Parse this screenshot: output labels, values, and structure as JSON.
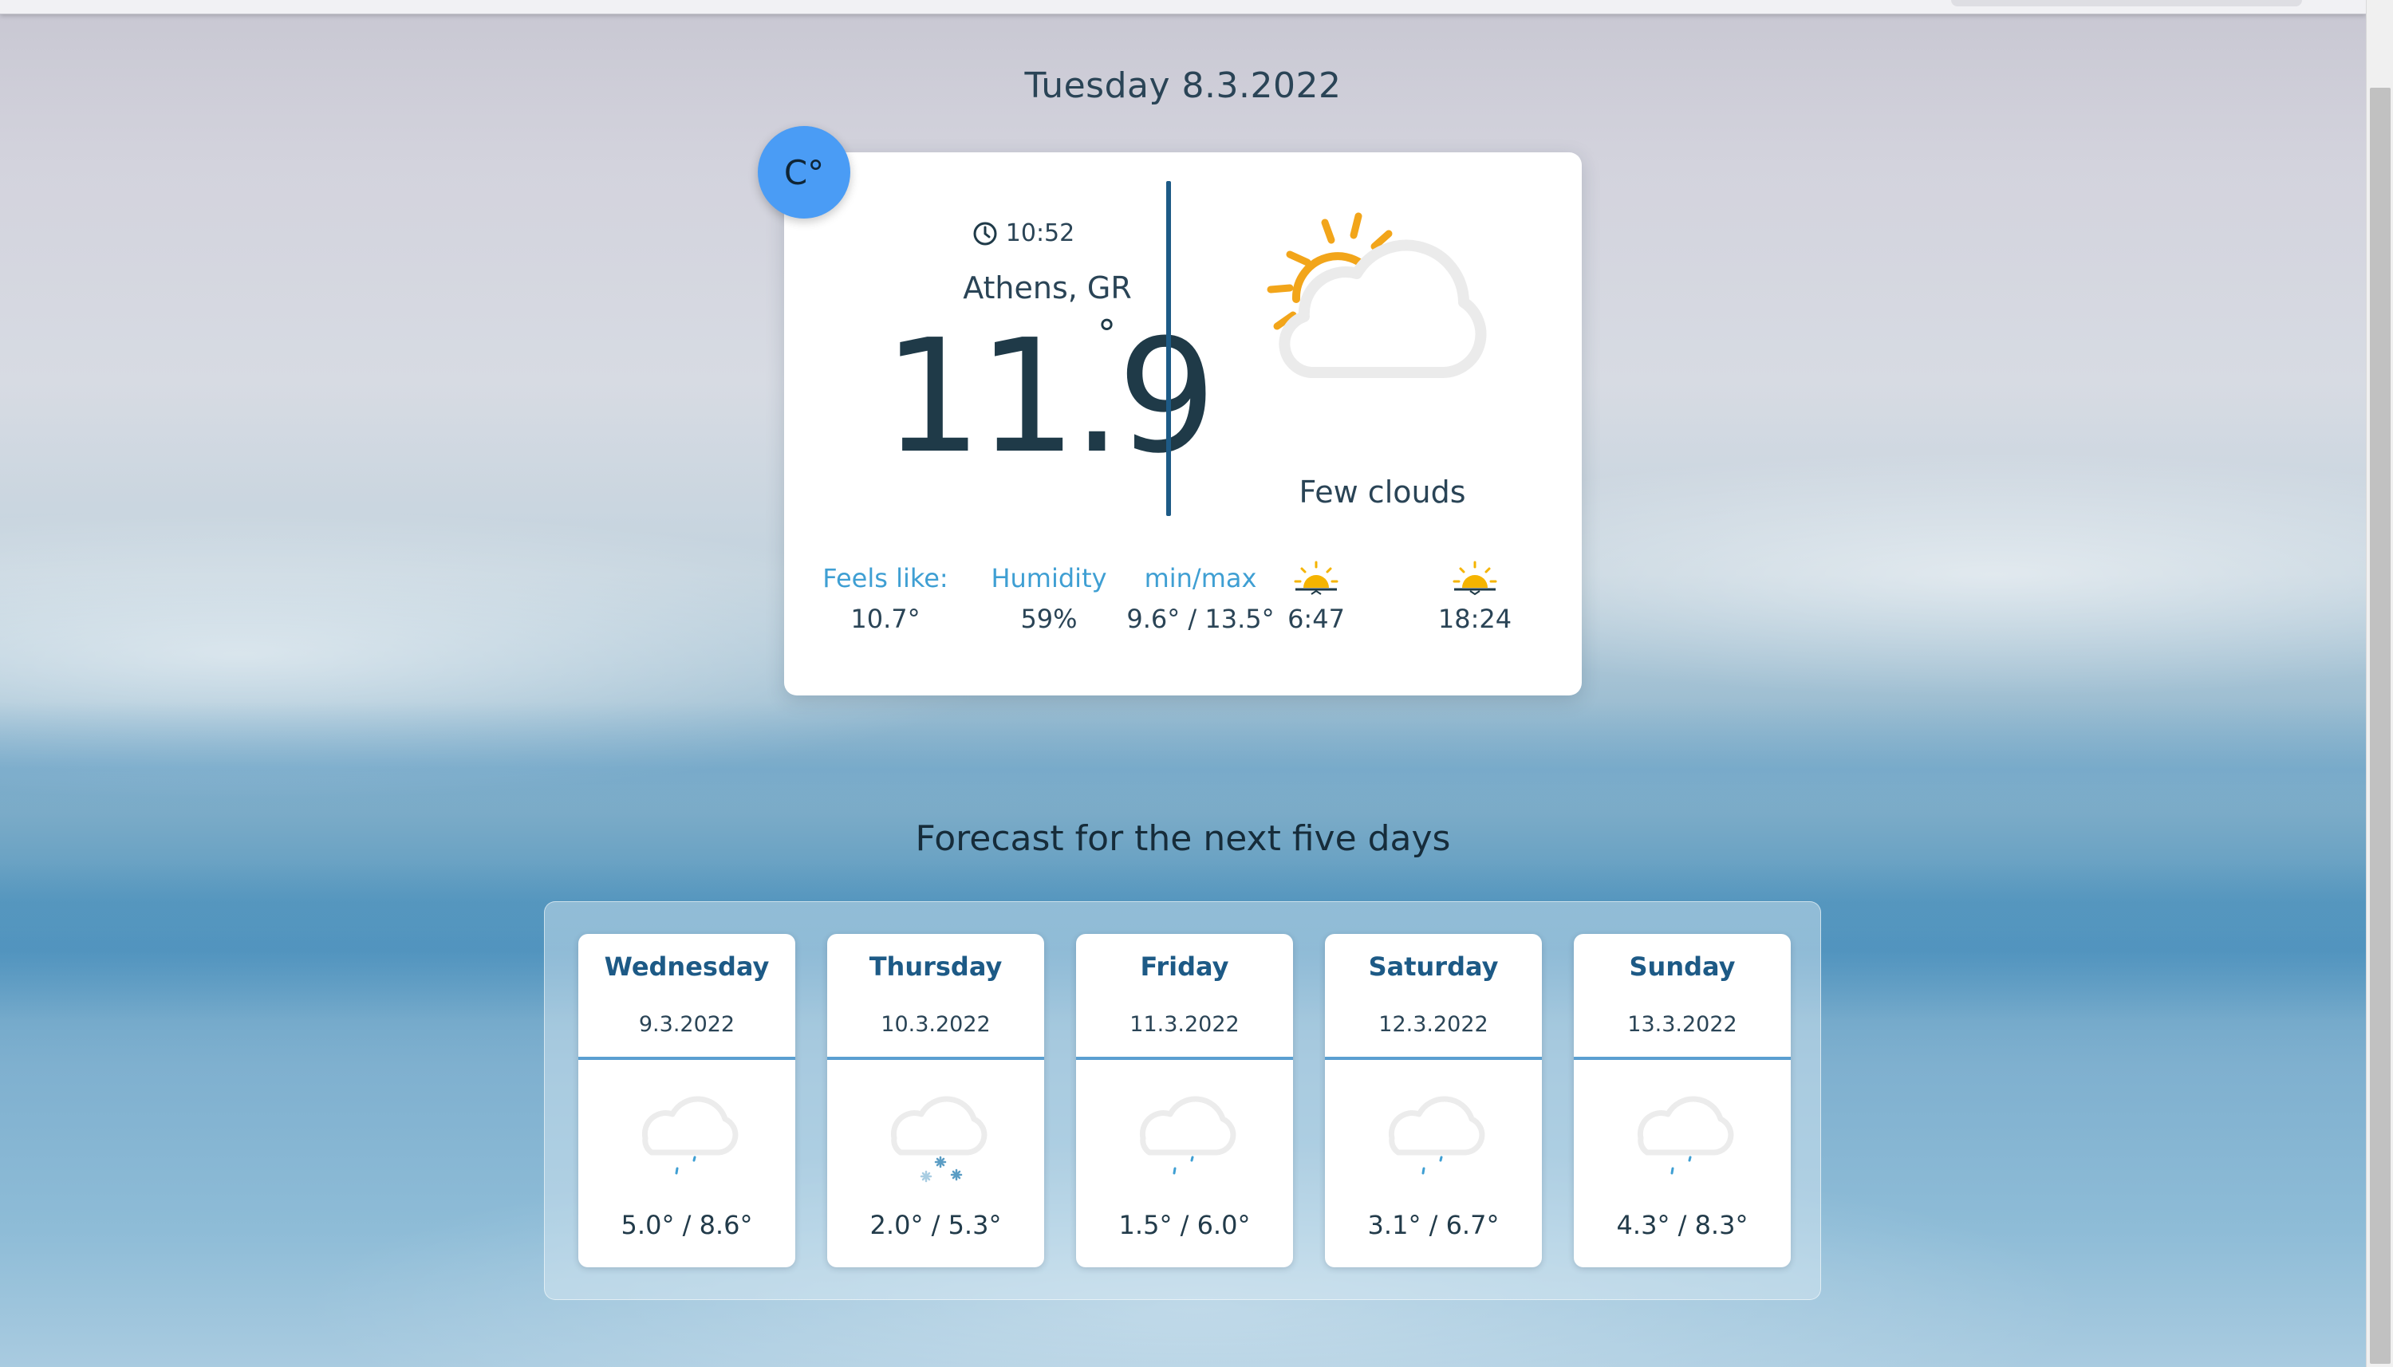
{
  "header": {
    "date": "Tuesday 8.3.2022"
  },
  "unit_toggle": {
    "label": "C°"
  },
  "current": {
    "time": "10:52",
    "city": "Athens, GR",
    "temperature": "11.9",
    "degree_symbol": "°",
    "condition": "Few clouds",
    "icon": "sun-behind-cloud-icon",
    "stats": [
      {
        "label": "Feels like:",
        "value": "10.7°"
      },
      {
        "label": "Humidity",
        "value": "59%"
      },
      {
        "label": "min/max",
        "value": "9.6° / 13.5°"
      }
    ],
    "sunrise": {
      "icon": "sunrise-icon",
      "value": "6:47"
    },
    "sunset": {
      "icon": "sunset-icon",
      "value": "18:24"
    }
  },
  "forecast": {
    "heading": "Forecast for the next five days",
    "days": [
      {
        "name": "Wednesday",
        "date": "9.3.2022",
        "range": "5.0° / 8.6°",
        "icon": "cloud-rain-icon"
      },
      {
        "name": "Thursday",
        "date": "10.3.2022",
        "range": "2.0° / 5.3°",
        "icon": "cloud-snow-icon"
      },
      {
        "name": "Friday",
        "date": "11.3.2022",
        "range": "1.5° / 6.0°",
        "icon": "cloud-rain-icon"
      },
      {
        "name": "Saturday",
        "date": "12.3.2022",
        "range": "3.1° / 6.7°",
        "icon": "cloud-rain-icon"
      },
      {
        "name": "Sunday",
        "date": "13.3.2022",
        "range": "4.3° / 8.3°",
        "icon": "cloud-rain-icon"
      }
    ]
  },
  "colors": {
    "accent": "#4a9cf5",
    "label_blue": "#3f9fd3",
    "divider": "#1d5a86",
    "sun": "#f2a51a"
  }
}
